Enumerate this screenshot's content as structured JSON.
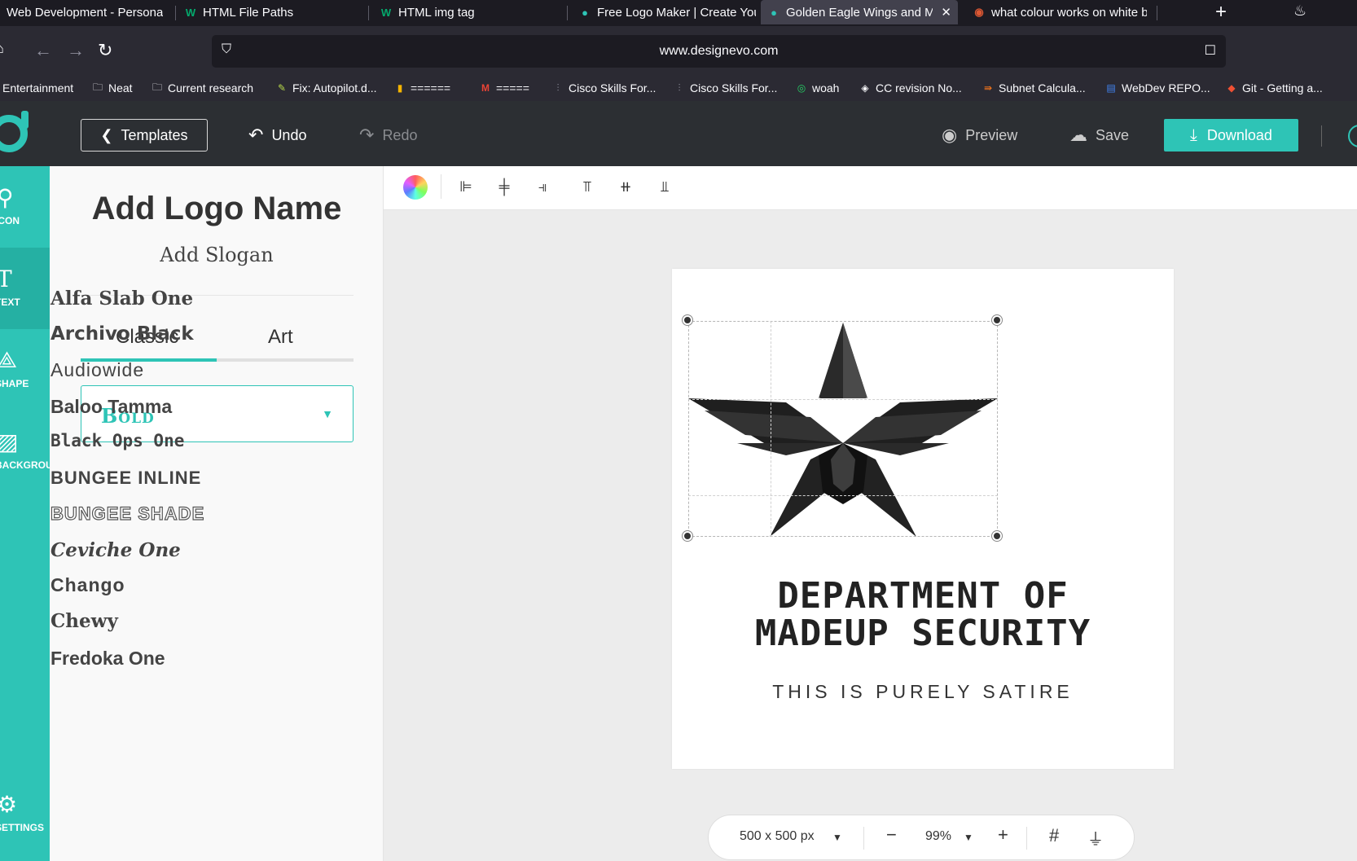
{
  "browser": {
    "tabs": [
      {
        "title": "Web Development - Personal",
        "icon": "folder-icon"
      },
      {
        "title": "HTML File Paths",
        "icon": "w3schools-icon"
      },
      {
        "title": "HTML img tag",
        "icon": "w3schools-icon"
      },
      {
        "title": "Free Logo Maker | Create You",
        "icon": "designevo-icon"
      },
      {
        "title": "Golden Eagle Wings and Mil",
        "icon": "designevo-icon"
      },
      {
        "title": "what colour works on white b",
        "icon": "duckduckgo-icon"
      }
    ],
    "url": "www.designevo.com",
    "bookmarks": [
      "Entertainment",
      "Neat",
      "Current research",
      "Fix: Autopilot.d...",
      "======",
      "=====",
      "Cisco Skills For...",
      "Cisco Skills For...",
      "woah",
      "CC revision No...",
      "Subnet Calcula...",
      "WebDev REPO...",
      "Git - Getting a..."
    ]
  },
  "header": {
    "templates_label": "Templates",
    "undo_label": "Undo",
    "redo_label": "Redo",
    "preview_label": "Preview",
    "save_label": "Save",
    "download_label": "Download"
  },
  "rail": {
    "items": [
      {
        "label": "ICON",
        "icon": "search-icon"
      },
      {
        "label": "TEXT",
        "icon": "text-icon"
      },
      {
        "label": "SHAPE",
        "icon": "shape-icon"
      },
      {
        "label": "BACKGROUND",
        "icon": "background-icon"
      },
      {
        "label": "SETTINGS",
        "icon": "gear-icon"
      }
    ]
  },
  "panel": {
    "logo_name": "Add Logo Name",
    "slogan": "Add Slogan",
    "tabs": [
      "Classic",
      "Art"
    ],
    "active_tab": "Classic",
    "font_category": "Bold",
    "fonts": [
      "Alfa Slab One",
      "Archivo Black",
      "Audiowide",
      "Baloo Tamma",
      "Black Ops One",
      "BUNGEE INLINE",
      "BUNGEE SHADE",
      "Ceviche One",
      "Chango",
      "Chewy",
      "Fredoka One"
    ]
  },
  "canvas": {
    "title_line1": "DEPARTMENT OF",
    "title_line2": "MADEUP SECURITY",
    "slogan": "THIS IS PURELY SATIRE",
    "size_label": "500 x 500 px",
    "zoom": "99%",
    "colors": {
      "accent": "#2ec4b6",
      "emblem": "#1f1f1f"
    }
  }
}
